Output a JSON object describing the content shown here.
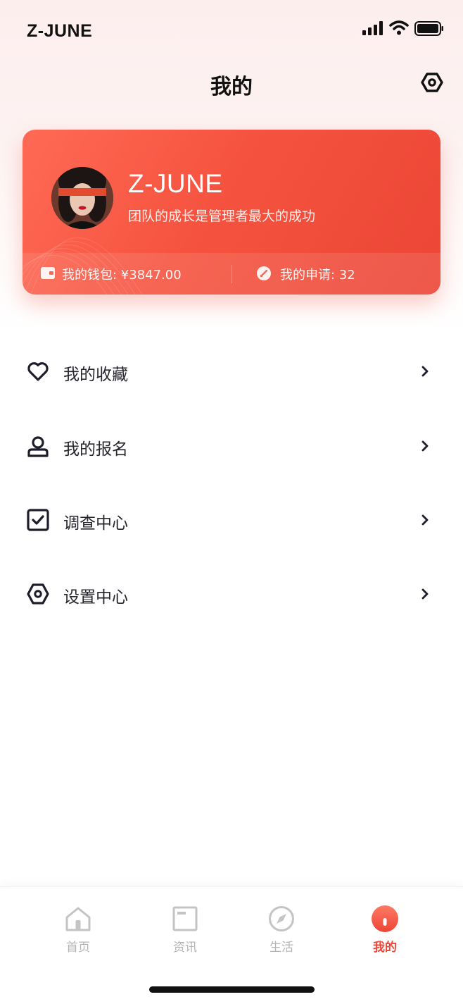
{
  "status_bar": {
    "carrier": "Z-JUNE"
  },
  "nav": {
    "title": "我的"
  },
  "profile": {
    "name": "Z-JUNE",
    "motto": "团队的成长是管理者最大的成功",
    "wallet_label": "我的钱包: ¥3847.00",
    "apply_label": "我的申请: 32"
  },
  "menu": {
    "items": [
      {
        "label": "我的收藏",
        "icon": "heart-icon"
      },
      {
        "label": "我的报名",
        "icon": "user-icon"
      },
      {
        "label": "调查中心",
        "icon": "checkbox-icon"
      },
      {
        "label": "设置中心",
        "icon": "settings-hex-icon"
      }
    ]
  },
  "tabs": [
    {
      "label": "首页",
      "icon": "home-icon",
      "active": false
    },
    {
      "label": "资讯",
      "icon": "news-icon",
      "active": false
    },
    {
      "label": "生活",
      "icon": "compass-icon",
      "active": false
    },
    {
      "label": "我的",
      "icon": "profile-icon",
      "active": true
    }
  ],
  "colors": {
    "accent": "#ec4636",
    "accent_light": "#ff6a55",
    "inactive": "#b4b4b4",
    "text": "#26262e"
  }
}
